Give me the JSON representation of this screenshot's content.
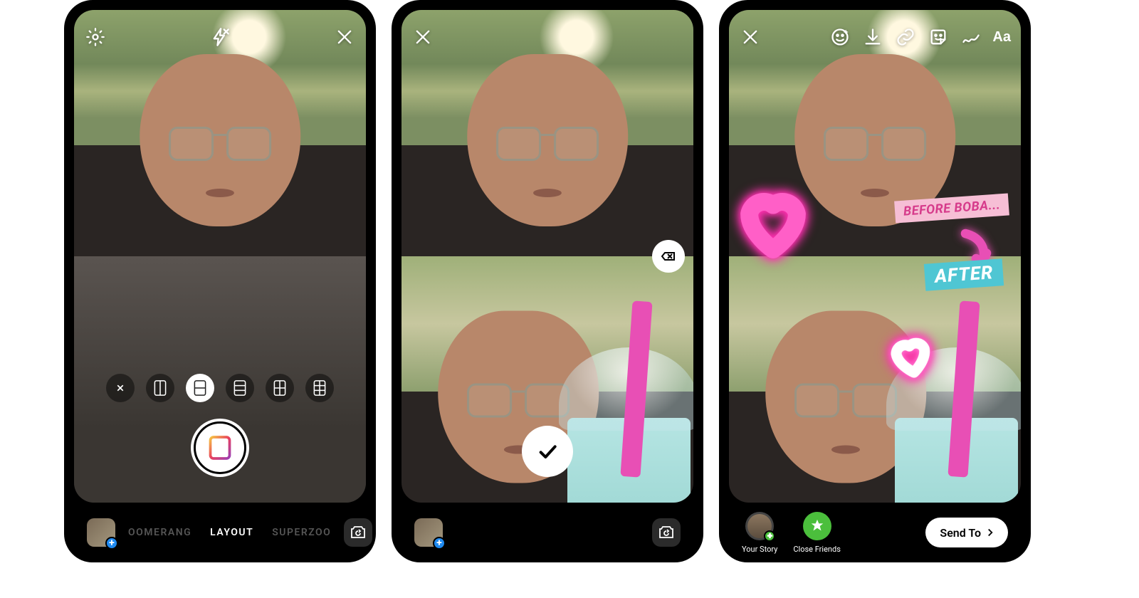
{
  "screen1": {
    "modes": {
      "prev": "OOMERANG",
      "active": "LAYOUT",
      "next": "SUPERZOO"
    },
    "layout_options": [
      "close",
      "2v",
      "2h-sel",
      "3h",
      "2x2a",
      "2x3"
    ]
  },
  "screen3": {
    "sticker_before": "BEFORE BOBA...",
    "sticker_after": "AFTER",
    "your_story": "Your Story",
    "close_friends": "Close Friends",
    "send_to": "Send To"
  }
}
